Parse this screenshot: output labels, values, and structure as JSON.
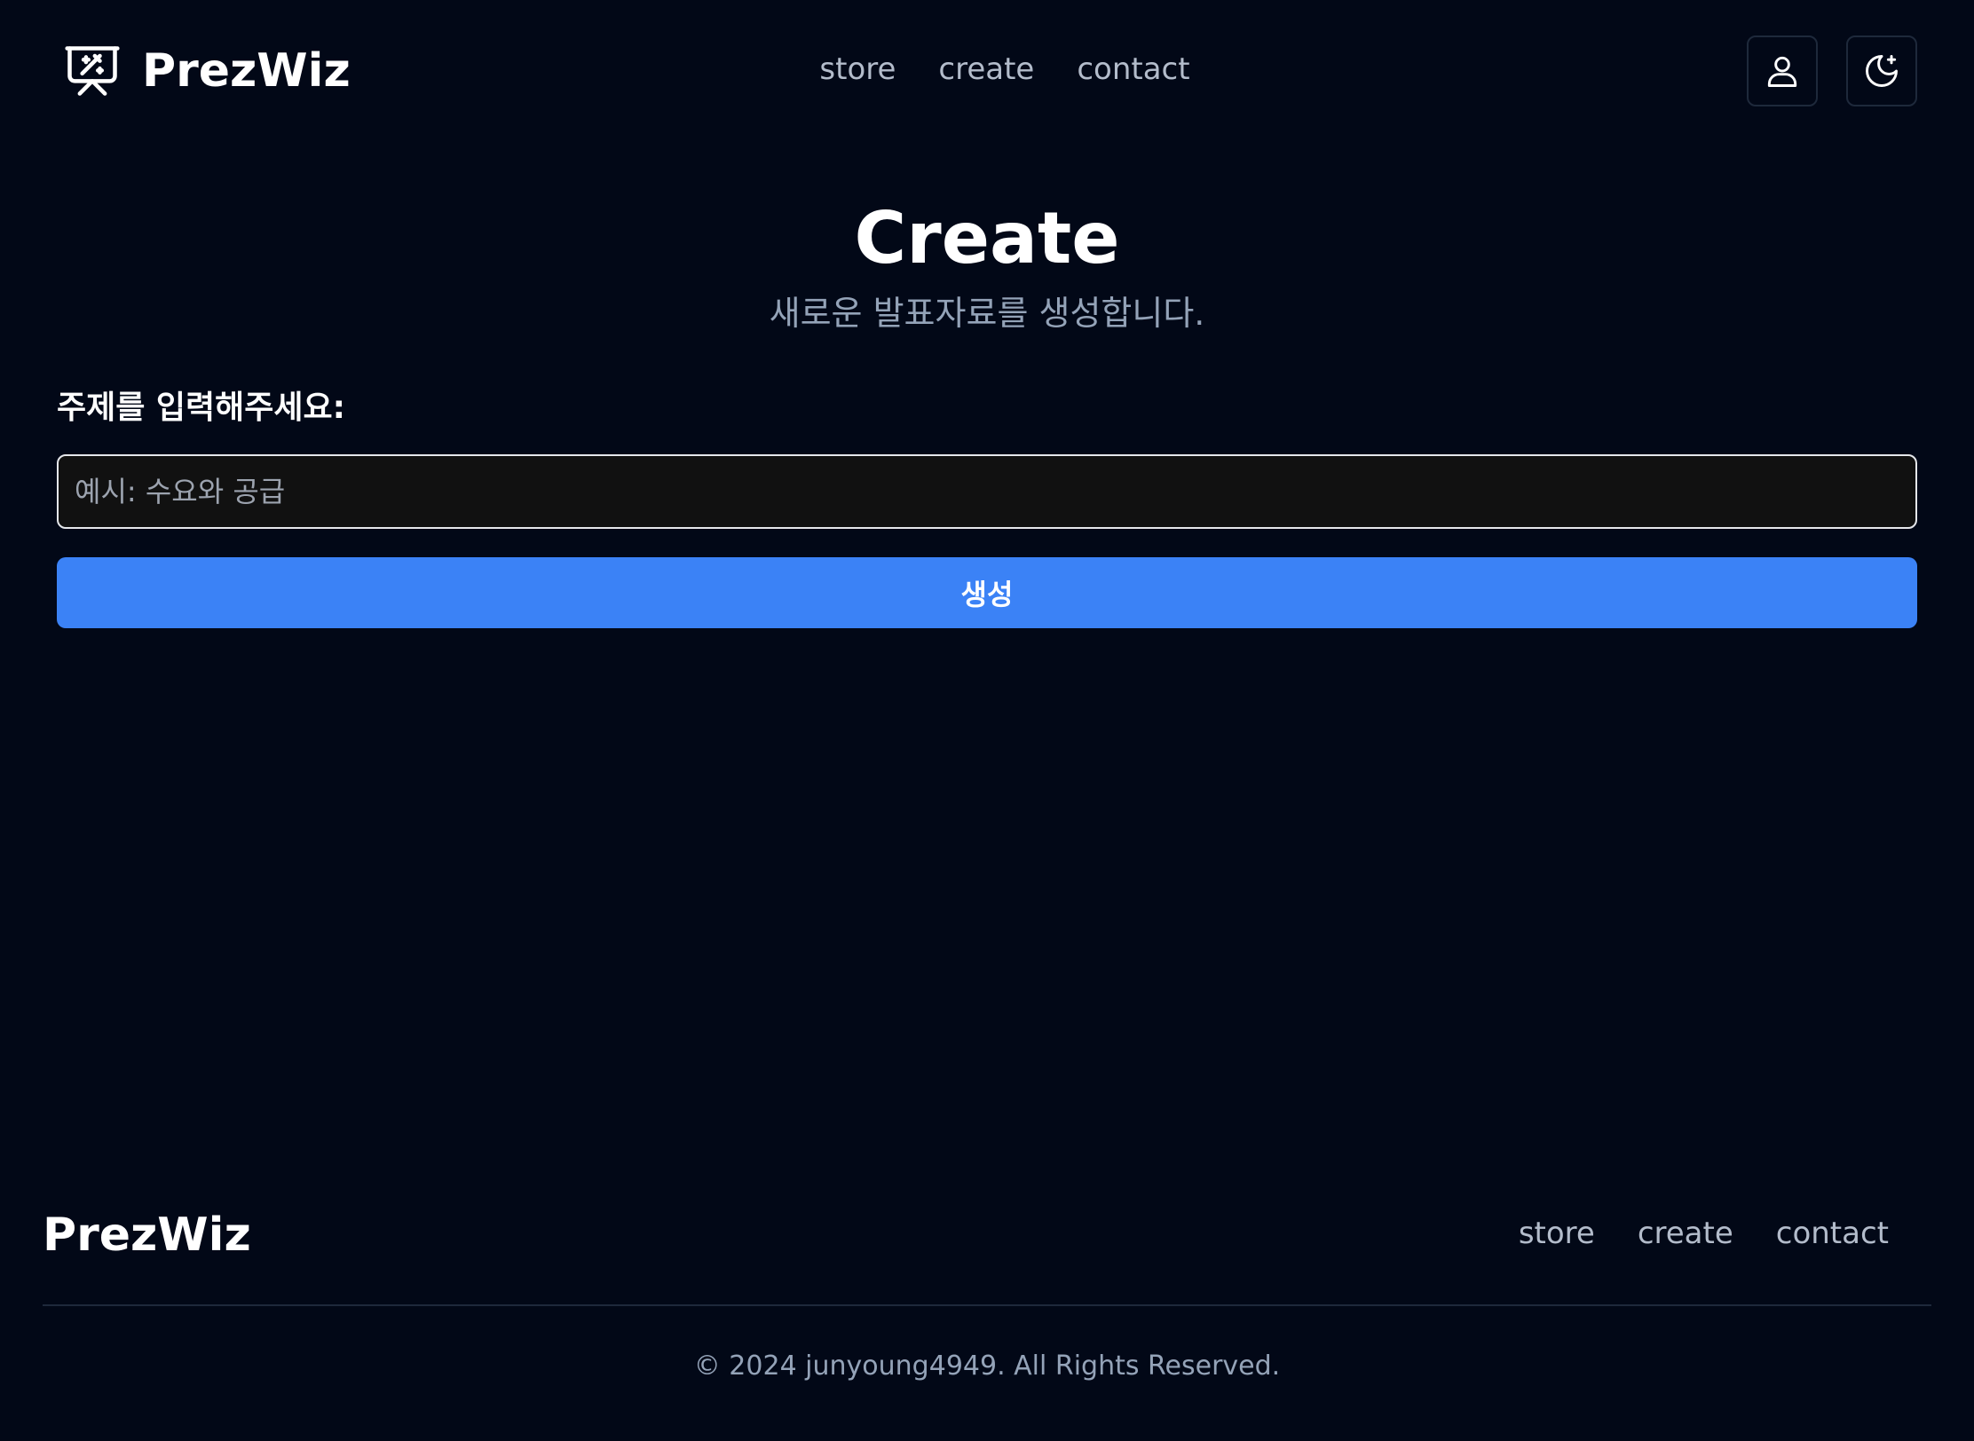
{
  "header": {
    "brand_name": "PrezWiz",
    "brand_icon": "presentation-wand-icon",
    "nav": [
      {
        "label": "store"
      },
      {
        "label": "create"
      },
      {
        "label": "contact"
      }
    ],
    "user_icon": "user-icon",
    "theme_icon": "moon-sparkle-icon"
  },
  "hero": {
    "title": "Create",
    "subtitle": "새로운 발표자료를 생성합니다."
  },
  "form": {
    "label": "주제를 입력해주세요:",
    "input_value": "",
    "input_placeholder": "예시: 수요와 공급",
    "submit_label": "생성"
  },
  "footer": {
    "brand_name": "PrezWiz",
    "nav": [
      {
        "label": "store"
      },
      {
        "label": "create"
      },
      {
        "label": "contact"
      }
    ],
    "copyright": "© 2024 junyoung4949. All Rights Reserved."
  },
  "colors": {
    "background": "#020817",
    "accent": "#3b82f6",
    "muted_text": "#94a3b8",
    "input_background": "#111111"
  }
}
